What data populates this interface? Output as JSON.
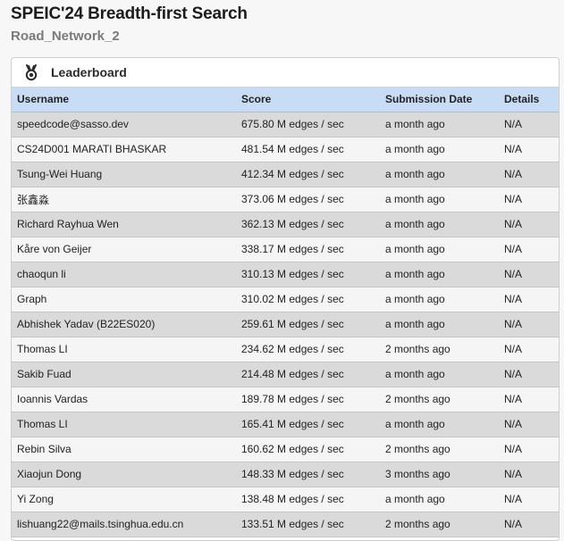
{
  "page": {
    "title": "SPEIC'24 Breadth-first Search",
    "subtitle": "Road_Network_2"
  },
  "leaderboard": {
    "icon": "trophy-icon",
    "title": "Leaderboard",
    "columns": [
      "Username",
      "Score",
      "Submission Date",
      "Details"
    ],
    "rows": [
      {
        "username": "speedcode@sasso.dev",
        "score": "675.80 M edges / sec",
        "date": "a month ago",
        "details": "N/A"
      },
      {
        "username": "CS24D001 MARATI BHASKAR",
        "score": "481.54 M edges / sec",
        "date": "a month ago",
        "details": "N/A"
      },
      {
        "username": "Tsung-Wei Huang",
        "score": "412.34 M edges / sec",
        "date": "a month ago",
        "details": "N/A"
      },
      {
        "username": "张鑫淼",
        "score": "373.06 M edges / sec",
        "date": "a month ago",
        "details": "N/A"
      },
      {
        "username": "Richard Rayhua Wen",
        "score": "362.13 M edges / sec",
        "date": "a month ago",
        "details": "N/A"
      },
      {
        "username": "Kåre von Geijer",
        "score": "338.17 M edges / sec",
        "date": "a month ago",
        "details": "N/A"
      },
      {
        "username": "chaoqun li",
        "score": "310.13 M edges / sec",
        "date": "a month ago",
        "details": "N/A"
      },
      {
        "username": "Graph",
        "score": "310.02 M edges / sec",
        "date": "a month ago",
        "details": "N/A"
      },
      {
        "username": "Abhishek Yadav (B22ES020)",
        "score": "259.61 M edges / sec",
        "date": "a month ago",
        "details": "N/A"
      },
      {
        "username": "Thomas LI",
        "score": "234.62 M edges / sec",
        "date": "2 months ago",
        "details": "N/A"
      },
      {
        "username": "Sakib Fuad",
        "score": "214.48 M edges / sec",
        "date": "a month ago",
        "details": "N/A"
      },
      {
        "username": "Ioannis Vardas",
        "score": "189.78 M edges / sec",
        "date": "2 months ago",
        "details": "N/A"
      },
      {
        "username": "Thomas LI",
        "score": "165.41 M edges / sec",
        "date": "a month ago",
        "details": "N/A"
      },
      {
        "username": "Rebin Silva",
        "score": "160.62 M edges / sec",
        "date": "2 months ago",
        "details": "N/A"
      },
      {
        "username": "Xiaojun Dong",
        "score": "148.33 M edges / sec",
        "date": "3 months ago",
        "details": "N/A"
      },
      {
        "username": "Yi Zong",
        "score": "138.48 M edges / sec",
        "date": "a month ago",
        "details": "N/A"
      },
      {
        "username": "lishuang22@mails.tsinghua.edu.cn",
        "score": "133.51 M edges / sec",
        "date": "2 months ago",
        "details": "N/A"
      }
    ]
  }
}
